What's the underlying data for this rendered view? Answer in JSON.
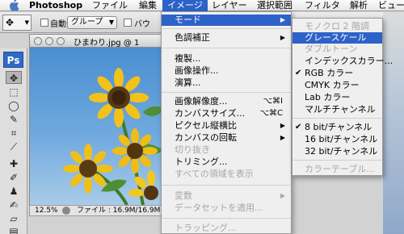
{
  "menubar": {
    "app": "Photoshop",
    "items": [
      "ファイル",
      "編集",
      "イメージ",
      "レイヤー",
      "選択範囲",
      "フィルタ",
      "解析",
      "ビュー"
    ],
    "active": "イメージ"
  },
  "options": {
    "auto_select_label": "自動選択 :",
    "group_value": "グループ",
    "bounding_label": "バウ"
  },
  "tools": {
    "badge": "Ps",
    "icons": [
      "move-icon",
      "marquee-icon",
      "lasso-icon",
      "quick-select-icon",
      "crop-icon",
      "eyedropper-icon",
      "healing-icon",
      "brush-icon",
      "clone-stamp-icon",
      "history-brush-icon",
      "eraser-icon",
      "gradient-icon"
    ]
  },
  "document": {
    "title": "ひまわり.jpg @ 1",
    "zoom": "12.5%",
    "file_info": "ファイル : 16.9M/16.9M"
  },
  "image_menu": {
    "items": [
      {
        "label": "モード",
        "submenu": true,
        "highlighted": true
      },
      {
        "label": "色調補正",
        "submenu": true
      },
      {
        "label": "複製..."
      },
      {
        "label": "画像操作..."
      },
      {
        "label": "演算..."
      },
      {
        "label": "画像解像度...",
        "shortcut": "⌥⌘I"
      },
      {
        "label": "カンバスサイズ...",
        "shortcut": "⌥⌘C"
      },
      {
        "label": "ピクセル縦横比",
        "submenu": true
      },
      {
        "label": "カンバスの回転",
        "submenu": true
      },
      {
        "label": "切り抜き",
        "disabled": true
      },
      {
        "label": "トリミング..."
      },
      {
        "label": "すべての領域を表示",
        "disabled": true
      },
      {
        "label": "変数",
        "submenu": true,
        "disabled": true
      },
      {
        "label": "データセットを適用...",
        "disabled": true
      },
      {
        "label": "トラッピング...",
        "disabled": true
      }
    ]
  },
  "mode_menu": {
    "items": [
      {
        "label": "モノクロ 2 階調",
        "disabled": true
      },
      {
        "label": "グレースケール",
        "highlighted": true
      },
      {
        "label": "ダブルトーン",
        "disabled": true
      },
      {
        "label": "インデックスカラー..."
      },
      {
        "label": "RGB カラー",
        "checked": true
      },
      {
        "label": "CMYK カラー"
      },
      {
        "label": "Lab カラー"
      },
      {
        "label": "マルチチャンネル"
      },
      {
        "label": "8 bit/チャンネル",
        "checked": true
      },
      {
        "label": "16 bit/チャンネル"
      },
      {
        "label": "32 bit/チャンネル"
      },
      {
        "label": "カラーテーブル...",
        "disabled": true
      }
    ]
  },
  "colors": {
    "accent": "#2d62c8",
    "ps_badge": "#2d6bc6",
    "sky": "#5b9ad6",
    "sunflower": "#f2c21b"
  }
}
